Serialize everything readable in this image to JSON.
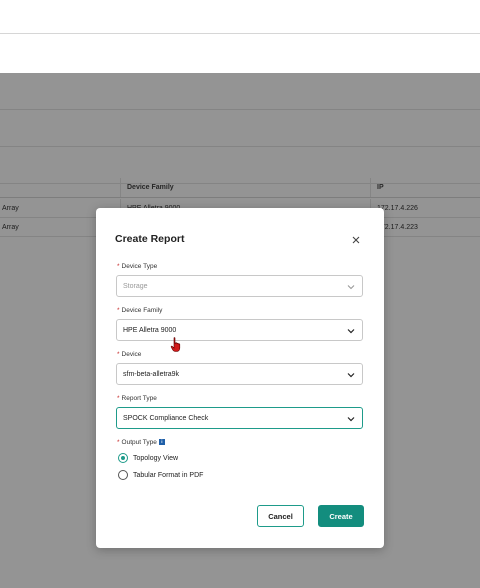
{
  "table": {
    "headers": [
      "",
      "Device Family",
      "IP"
    ],
    "rows": [
      {
        "name": "Array",
        "family": "HPE Alletra 9000",
        "ip": "172.17.4.226"
      },
      {
        "name": "Array",
        "family": "",
        "ip": "172.17.4.223"
      }
    ]
  },
  "modal": {
    "title": "Create Report",
    "close_icon": "close-icon",
    "fields": {
      "device_type": {
        "label": "Device Type",
        "value": "Storage",
        "required": true,
        "disabled": true
      },
      "device_family": {
        "label": "Device Family",
        "value": "HPE Alletra 9000",
        "required": true
      },
      "device": {
        "label": "Device",
        "value": "sfm-beta-alletra9k",
        "required": true
      },
      "report_type": {
        "label": "Report Type",
        "value": "SPOCK Compliance Check",
        "required": true
      }
    },
    "output_type": {
      "label": "Output Type",
      "info_icon": "i",
      "options": [
        {
          "label": "Topology View",
          "selected": true
        },
        {
          "label": "Tabular Format in PDF",
          "selected": false
        }
      ]
    },
    "buttons": {
      "cancel": "Cancel",
      "create": "Create"
    }
  },
  "colors": {
    "accent": "#138d7e",
    "required": "#c62828",
    "info": "#1f5fa8"
  }
}
